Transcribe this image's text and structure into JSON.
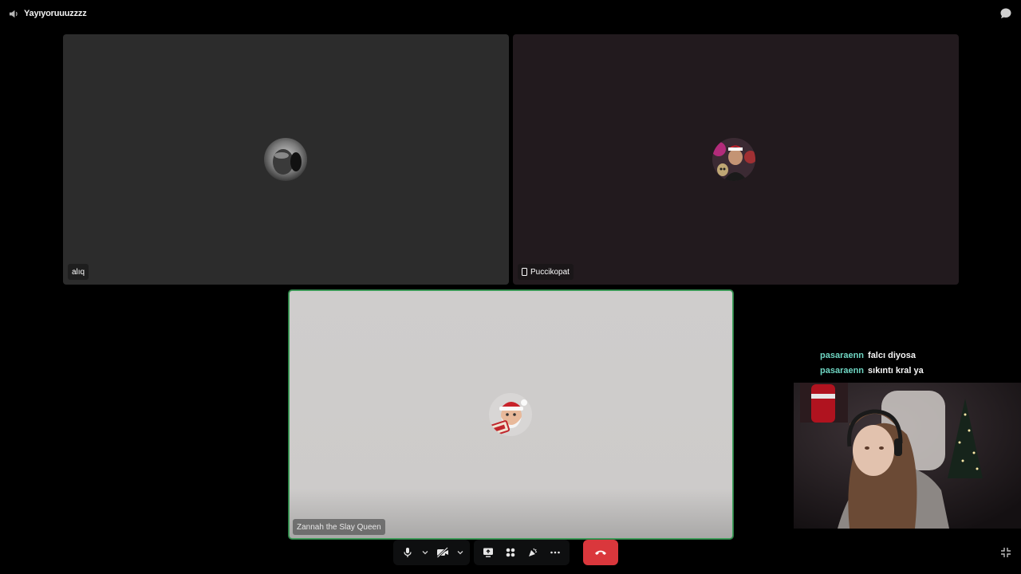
{
  "header": {
    "channel_name": "Yayıyoruuuzzzz",
    "channel_icon": "speaker-icon",
    "chat_icon": "chat-bubble-icon"
  },
  "participants": [
    {
      "name": "alıq",
      "icon": "none"
    },
    {
      "name": "Puccikopat",
      "icon": "mobile-phone-icon"
    },
    {
      "name": "Zannah the Slay Queen",
      "icon": "none",
      "speaking": true
    }
  ],
  "chat": [
    {
      "user": "pasaraenn",
      "message": "falcı diyosa"
    },
    {
      "user": "pasaraenn",
      "message": "sıkıntı kral ya"
    }
  ],
  "controls": {
    "mic_icon": "microphone-icon",
    "camera_icon": "camera-off-icon",
    "screenshare_icon": "screen-share-icon",
    "activities_icon": "activities-icon",
    "soundboard_icon": "soundboard-icon",
    "more_icon": "more-icon",
    "hangup_icon": "phone-hangup-icon",
    "collapse_icon": "collapse-icon"
  },
  "colors": {
    "background": "#000000",
    "speaking_border": "#3fa05b",
    "hangup": "#da373c",
    "chat_username": "#6fd6c3"
  }
}
